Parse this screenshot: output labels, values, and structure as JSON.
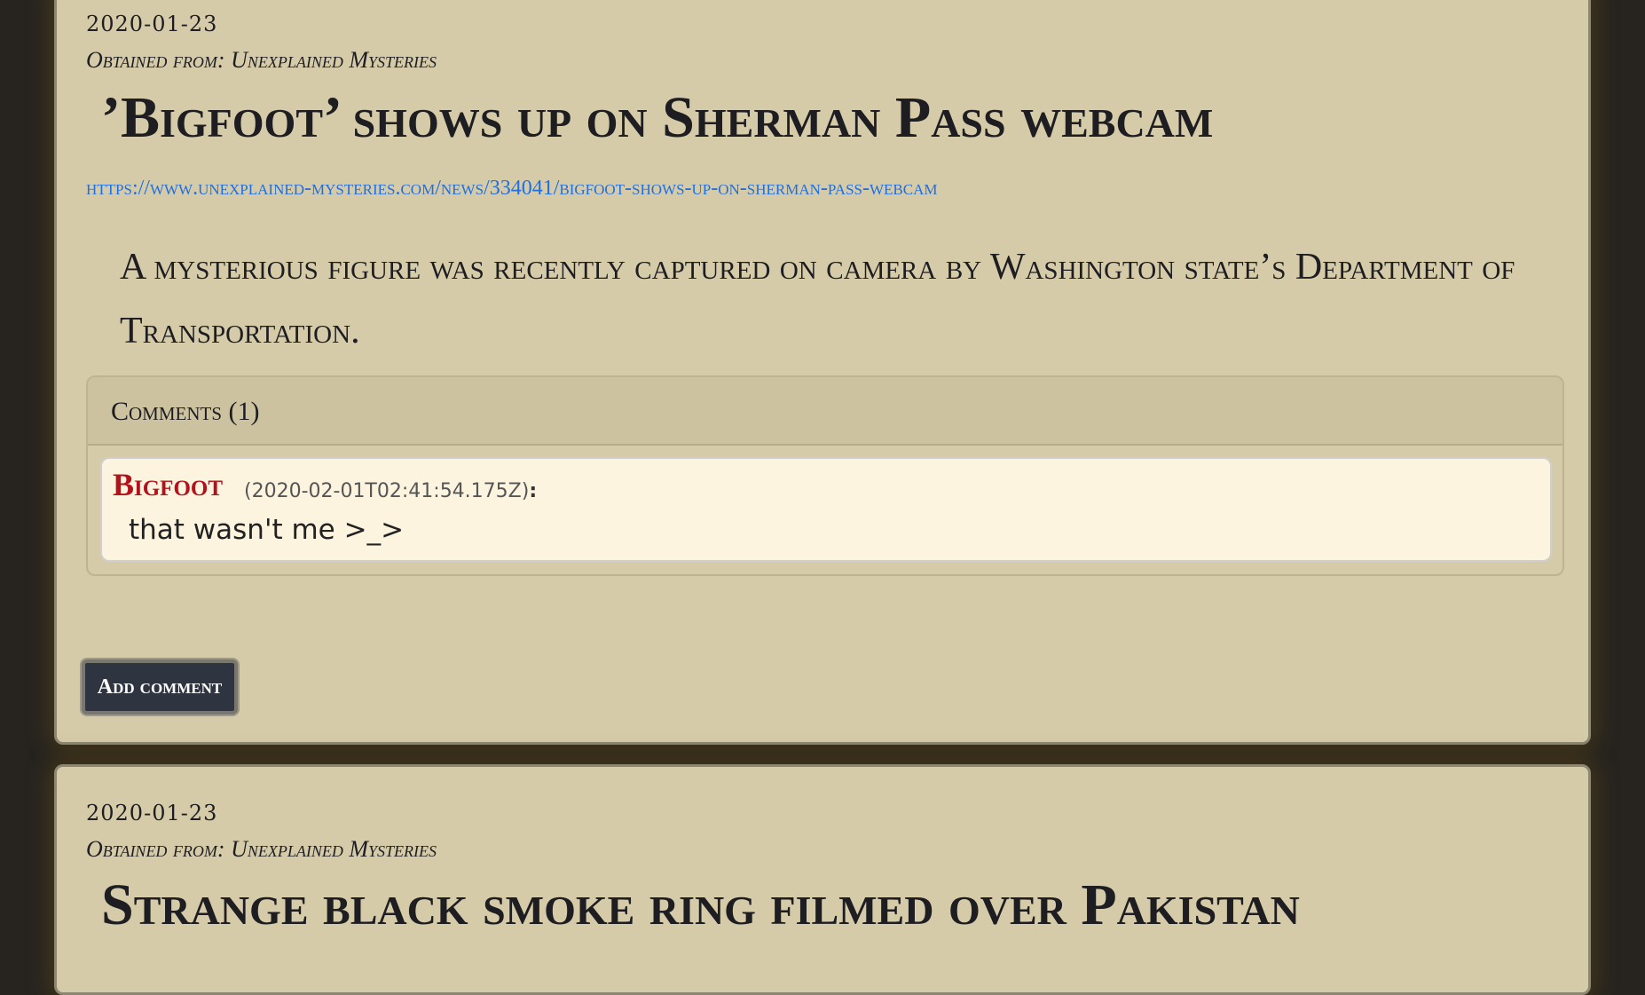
{
  "posts": [
    {
      "date": "2020-01-23",
      "source": "Obtained from: Unexplained Mysteries",
      "title": "’Bigfoot’ shows up on Sherman Pass webcam",
      "url": "https://www.unexplained-mysteries.com/news/334041/bigfoot-shows-up-on-sherman-pass-webcam",
      "summary": "A mysterious figure was recently captured on camera by Washington state’s Department of Transportation.",
      "comments_header": "Comments (1)",
      "comments": [
        {
          "author": "Bigfoot",
          "timestamp": "(2020-02-01T02:41:54.175Z)",
          "colon": ":",
          "text": "that wasn't me >_>"
        }
      ],
      "add_comment_label": "Add comment"
    },
    {
      "date": "2020-01-23",
      "source": "Obtained from: Unexplained Mysteries",
      "title": "Strange black smoke ring filmed over Pakistan"
    }
  ],
  "colors": {
    "background": "#272420",
    "card": "#d6cba9",
    "link": "#1f6fe0",
    "author": "#b3121a",
    "comment_bg": "#fdf4e0",
    "button": "#2e3440"
  }
}
